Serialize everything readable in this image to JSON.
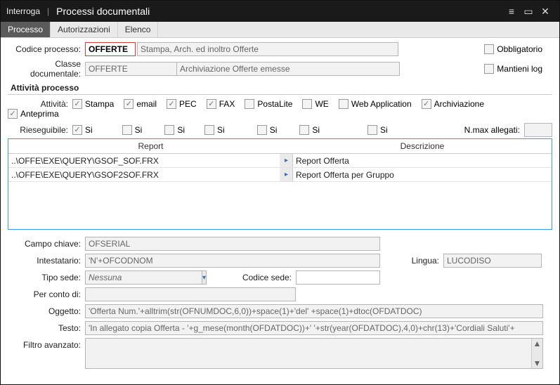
{
  "title": {
    "mode": "Interroga",
    "name": "Processi documentali"
  },
  "tabs": [
    "Processo",
    "Autorizzazioni",
    "Elenco"
  ],
  "codice": {
    "label": "Codice processo:",
    "value": "OFFERTE",
    "desc": "Stampa, Arch. ed inoltro Offerte"
  },
  "classe": {
    "label": "Classe documentale:",
    "value": "OFFERTE",
    "desc": "Archiviazione Offerte emesse"
  },
  "right": {
    "obbl": "Obbligatorio",
    "log": "Mantieni log"
  },
  "section": "Attività processo",
  "attivita_label": "Attività:",
  "attivita": [
    "Stampa",
    "email",
    "PEC",
    "FAX",
    "PostaLite",
    "WE",
    "Web Application",
    "Archiviazione",
    "Anteprima"
  ],
  "rieseg_label": "Rieseguibile:",
  "si": "Si",
  "nmax_label": "N.max allegati:",
  "grid": {
    "cols": [
      "Report",
      "Descrizione"
    ],
    "rows": [
      {
        "r": "..\\OFFE\\EXE\\QUERY\\GSOF_SOF.FRX",
        "d": "Report Offerta"
      },
      {
        "r": "..\\OFFE\\EXE\\QUERY\\GSOF2SOF.FRX",
        "d": "Report Offerta per Gruppo"
      }
    ]
  },
  "fields": {
    "campo": {
      "l": "Campo chiave:",
      "v": "OFSERIAL"
    },
    "intest": {
      "l": "Intestatario:",
      "v": "'N'+OFCODNOM"
    },
    "lingua": {
      "l": "Lingua:",
      "v": "LUCODISO"
    },
    "tipo": {
      "l": "Tipo sede:",
      "v": "Nessuna"
    },
    "codsede": {
      "l": "Codice sede:",
      "v": ""
    },
    "perconto": {
      "l": "Per conto di:",
      "v": ""
    },
    "oggetto": {
      "l": "Oggetto:",
      "v": "'Offerta Num.'+alltrim(str(OFNUMDOC,6,0))+space(1)+'del' +space(1)+dtoc(OFDATDOC)"
    },
    "testo": {
      "l": "Testo:",
      "v": "'In allegato copia Offerta - '+g_mese(month(OFDATDOC))+' '+str(year(OFDATDOC),4,0)+chr(13)+'Cordiali Saluti'+"
    },
    "filtro": {
      "l": "Filtro avanzato:",
      "v": ""
    }
  }
}
